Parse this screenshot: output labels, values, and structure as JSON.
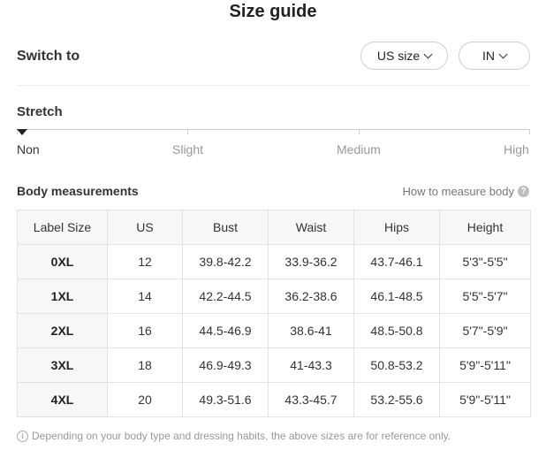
{
  "title": "Size guide",
  "switch": {
    "label": "Switch to",
    "size_system": "US size",
    "unit": "IN"
  },
  "stretch": {
    "title": "Stretch",
    "levels": [
      "Non",
      "Slight",
      "Medium",
      "High"
    ],
    "selected": "Non"
  },
  "body_measurements": {
    "title": "Body measurements",
    "how_to_measure": "How to measure body",
    "help_icon": "question-icon",
    "columns": [
      "Label Size",
      "US",
      "Bust",
      "Waist",
      "Hips",
      "Height"
    ],
    "rows": [
      [
        "0XL",
        "12",
        "39.8-42.2",
        "33.9-36.2",
        "43.7-46.1",
        "5'3\"-5'5\""
      ],
      [
        "1XL",
        "14",
        "42.2-44.5",
        "36.2-38.6",
        "46.1-48.5",
        "5'5\"-5'7\""
      ],
      [
        "2XL",
        "16",
        "44.5-46.9",
        "38.6-41",
        "48.5-50.8",
        "5'7\"-5'9\""
      ],
      [
        "3XL",
        "18",
        "46.9-49.3",
        "41-43.3",
        "50.8-53.2",
        "5'9\"-5'11\""
      ],
      [
        "4XL",
        "20",
        "49.3-51.6",
        "43.3-45.7",
        "53.2-55.6",
        "5'9\"-5'11\""
      ]
    ]
  },
  "note": {
    "icon": "info-icon",
    "text": "Depending on your body type and dressing habits, the above sizes are for reference only."
  }
}
